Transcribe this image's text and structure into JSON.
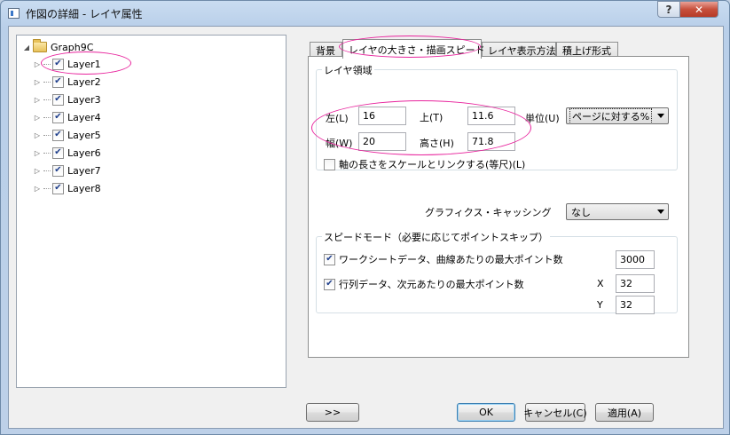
{
  "window": {
    "title": "作図の詳細 - レイヤ属性",
    "help_label": "?",
    "close_label": "✕"
  },
  "tree": {
    "root": {
      "label": "Graph9C",
      "icon": "folder-icon"
    },
    "items": [
      {
        "label": "Layer1",
        "checked": true
      },
      {
        "label": "Layer2",
        "checked": true
      },
      {
        "label": "Layer3",
        "checked": true
      },
      {
        "label": "Layer4",
        "checked": true
      },
      {
        "label": "Layer5",
        "checked": true
      },
      {
        "label": "Layer6",
        "checked": true
      },
      {
        "label": "Layer7",
        "checked": true
      },
      {
        "label": "Layer8",
        "checked": true
      }
    ]
  },
  "tabs": [
    {
      "label": "背景"
    },
    {
      "label": "レイヤの大きさ・描画スピード",
      "active": true
    },
    {
      "label": "レイヤ表示方法"
    },
    {
      "label": "積上げ形式"
    }
  ],
  "layer_area": {
    "title": "レイヤ領域",
    "left_label": "左(L)",
    "left_value": "16",
    "top_label": "上(T)",
    "top_value": "11.6",
    "width_label": "幅(W)",
    "width_value": "20",
    "height_label": "高さ(H)",
    "height_value": "71.8",
    "unit_label": "単位(U)",
    "unit_value": "ページに対する%",
    "link_label": "軸の長さをスケールとリンクする(等尺)(L)",
    "link_checked": false
  },
  "graphics": {
    "label": "グラフィクス・キャッシング",
    "value": "なし"
  },
  "speed": {
    "title": "スピードモード（必要に応じてポイントスキップ）",
    "worksheet_label": "ワークシートデータ、曲線あたりの最大ポイント数",
    "worksheet_checked": true,
    "worksheet_value": "3000",
    "matrix_label": "行列データ、次元あたりの最大ポイント数",
    "matrix_checked": true,
    "x_label": "X",
    "x_value": "32",
    "y_label": "Y",
    "y_value": "32"
  },
  "buttons": {
    "expand_label": ">>",
    "ok_label": "OK",
    "cancel_label": "キャンセル(C)",
    "apply_label": "適用(A)"
  },
  "colors": {
    "highlight": "#e8249d",
    "checkmark": "#1f3f8c"
  }
}
